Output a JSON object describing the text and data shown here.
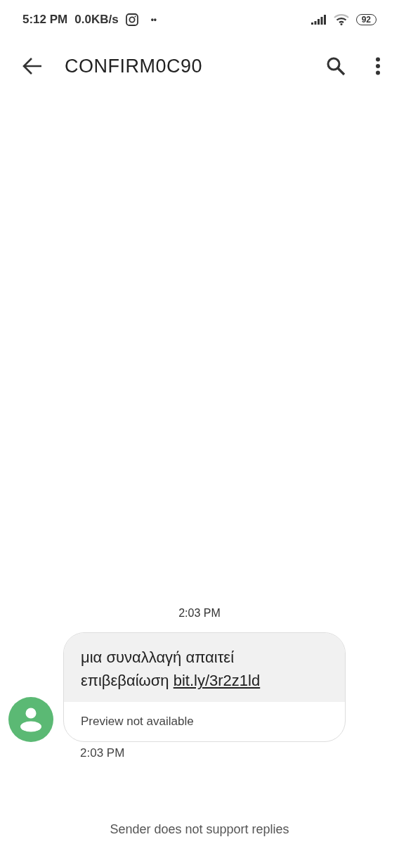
{
  "status_bar": {
    "time": "5:12 PM",
    "speed": "0.0KB/s",
    "dots": "••",
    "battery": "92"
  },
  "app_bar": {
    "title": "CONFIRM0C90"
  },
  "conversation": {
    "date_stamp": "2:03 PM",
    "messages": [
      {
        "text": "μια συναλλαγή απαιτεί επιβεβαίωση ",
        "link": "bit.ly/3r2z1ld",
        "preview": "Preview not available",
        "time": "2:03 PM"
      }
    ]
  },
  "footer": {
    "notice": "Sender does not support replies"
  }
}
